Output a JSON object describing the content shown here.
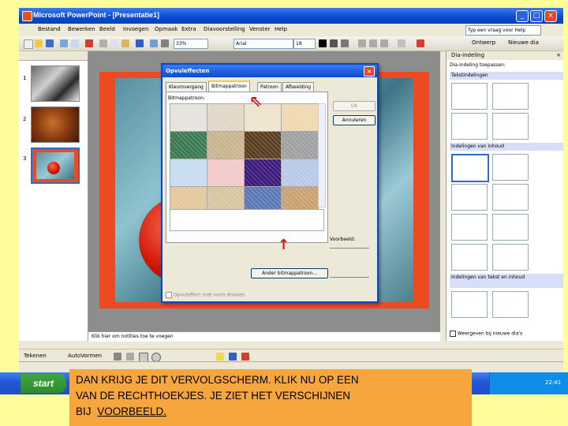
{
  "window": {
    "title": "Microsoft PowerPoint - [Presentatie1]",
    "min": "_",
    "max": "□",
    "close": "×"
  },
  "menu": {
    "items": [
      "Bestand",
      "Bewerken",
      "Beeld",
      "Invoegen",
      "Opmaak",
      "Extra",
      "Diavoorstelling",
      "Venster",
      "Help"
    ],
    "help_placeholder": "Typ een vraag voor Help"
  },
  "toolbar": {
    "zoom": "33%",
    "font": "Arial",
    "size": "18",
    "ontwerp": "Ontwerp",
    "nieuwe_dia": "Nieuwe dia"
  },
  "slides_panel": {
    "numbers": [
      "1",
      "2",
      "3"
    ]
  },
  "notes": {
    "placeholder": "Klik hier om notities toe te voegen"
  },
  "taskpane": {
    "title": "Dia-indeling",
    "apply_label": "Dia-indeling toepassen:",
    "sections": [
      "Tekstindelingen",
      "Indelingen van inhoud",
      "Indelingen van tekst en inhoud"
    ],
    "show_label": "Weergeven bij nieuwe dia's"
  },
  "dialog": {
    "title": "Opvuleffecten",
    "tabs": [
      "Kleurovergang",
      "Bitmappatroon",
      "Patroon",
      "Afbeelding"
    ],
    "texture_label": "Bitmappatroon:",
    "ok": "OK",
    "cancel": "Annuleren",
    "preview_label": "Voorbeeld:",
    "other_button": "Ander bitmappatroon...",
    "rotate_label": "Opvuleffect met vorm draaien"
  },
  "colors": {
    "textures": [
      "#e6e2dc",
      "#e2d6c4",
      "#efe3cc",
      "#f0d8b0",
      "#3a7a52",
      "#c9b48e",
      "#5a3c1e",
      "#9ea0a2",
      "#c7dcf0",
      "#f2c8c8",
      "#3a1a7a",
      "#b8c8e8",
      "#e2c89a",
      "#d8c6a0",
      "#5a78b8",
      "#caa070"
    ]
  },
  "drawbar": {
    "draw": "Tekenen",
    "autoshapes": "AutoVormen"
  },
  "taskbar": {
    "start": "start",
    "clock": "22:41"
  },
  "caption": {
    "line1": "DAN KRIJG JE DIT VERVOLGSCHERM. KLIK NU OP EEN",
    "line2": "VAN DE RECHTHOEKJES. JE ZIET HET VERSCHIJNEN",
    "line3_prefix": "BIJ",
    "line3_emph": "VOORBEELD."
  }
}
